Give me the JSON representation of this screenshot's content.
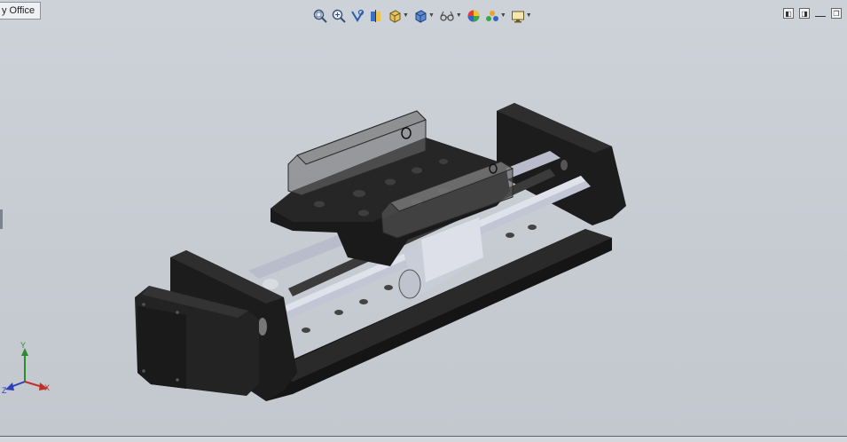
{
  "tab": {
    "label": "y Office"
  },
  "hud_toolbar": {
    "tools": [
      {
        "name": "zoom-to-fit"
      },
      {
        "name": "zoom-to-area"
      },
      {
        "name": "previous-view"
      },
      {
        "name": "section-view"
      },
      {
        "name": "view-orientation",
        "dropdown": true
      },
      {
        "name": "display-style",
        "dropdown": true
      },
      {
        "name": "hide-show-items",
        "dropdown": true
      },
      {
        "name": "edit-appearance",
        "dropdown": false
      },
      {
        "name": "apply-scene",
        "dropdown": true
      },
      {
        "name": "view-settings",
        "dropdown": true
      }
    ]
  },
  "triad": {
    "x_label": "X",
    "y_label": "Y",
    "z_label": "Z"
  },
  "colors": {
    "background": "#c6cbd2",
    "part_dark": "#1e1e1e",
    "rail": "#b8bccb",
    "x_axis": "#c0302a",
    "y_axis": "#2e8b2e",
    "z_axis": "#2a3fb8"
  }
}
